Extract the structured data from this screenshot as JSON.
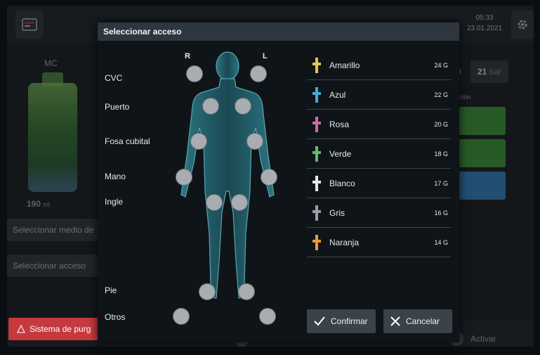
{
  "header": {
    "time": "05:33",
    "date": "23.01.2021"
  },
  "background": {
    "mc_label": "MC",
    "pressure_prefix": "t",
    "pressure_value": "21",
    "pressure_unit": "bar",
    "section_fragment": "ción",
    "volume_value": "190",
    "volume_unit": "ml",
    "select_medium_button": "Seleccionar medio de",
    "select_access_button": "Seleccionar acceso",
    "purge_button": "Sistema de purg",
    "activate_label": "Activar",
    "bottom_center_label": ""
  },
  "dialog": {
    "title": "Seleccionar acceso",
    "right_marker": "R",
    "left_marker": "L",
    "sites": [
      "CVC",
      "Puerto",
      "Fosa cubital",
      "Mano",
      "Ingle",
      "Pie",
      "Otros"
    ],
    "catheters": [
      {
        "name": "Amarillo",
        "gauge": "24 G",
        "color": "#e8c64a"
      },
      {
        "name": "Azul",
        "gauge": "22 G",
        "color": "#4aa8d8"
      },
      {
        "name": "Rosa",
        "gauge": "20 G",
        "color": "#d06aa8"
      },
      {
        "name": "Verde",
        "gauge": "18 G",
        "color": "#5cc06a"
      },
      {
        "name": "Blanco",
        "gauge": "17 G",
        "color": "#e8e8e8"
      },
      {
        "name": "Gris",
        "gauge": "16 G",
        "color": "#9aa0a6"
      },
      {
        "name": "Naranja",
        "gauge": "14 G",
        "color": "#e89a3a"
      }
    ],
    "confirm_label": "Confirmar",
    "cancel_label": "Cancelar"
  },
  "colors": {
    "purge_red": "#c6393d",
    "body_teal": "#3b8e9a",
    "spot_gray": "#a9adb1"
  }
}
